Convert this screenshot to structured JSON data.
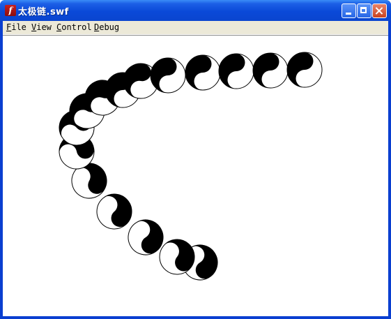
{
  "window": {
    "title": "太极链.swf",
    "app_icon_glyph": "f"
  },
  "menu": [
    {
      "label": "File",
      "accel": "F",
      "rest": "ile"
    },
    {
      "label": "View",
      "accel": "V",
      "rest": "iew"
    },
    {
      "label": "Control",
      "accel": "C",
      "rest": "ontrol"
    },
    {
      "label": "Debug",
      "accel": "D",
      "rest": "ebug"
    }
  ],
  "colors": {
    "title_bar": "#0a49d8",
    "menu_bg": "#ece9d8",
    "taiji_dark": "#000000",
    "taiji_light": "#ffffff"
  },
  "icons": [
    "flash-app-icon",
    "minimize-icon",
    "maximize-icon",
    "close-icon",
    "yin-yang-icon"
  ]
}
